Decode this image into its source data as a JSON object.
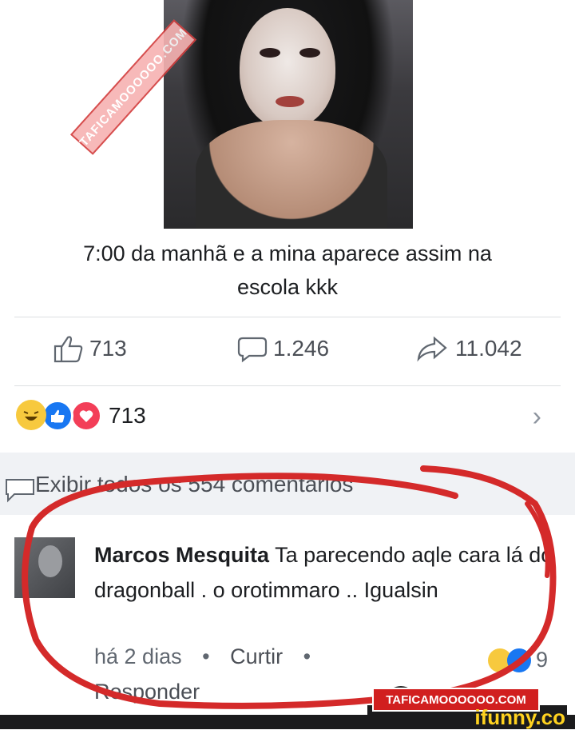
{
  "post": {
    "caption_line1": "7:00 da manhã e a mina aparece assim na",
    "caption_line2": "escola kkk",
    "photo_watermark": "TAFICAMOOOOOO.COM"
  },
  "stats": {
    "likes": "713",
    "comments": "1.246",
    "shares": "11.042"
  },
  "reactions": {
    "count": "713",
    "icons": [
      "haha-icon",
      "like-icon",
      "love-icon"
    ],
    "chevron": "›"
  },
  "comments_bar": {
    "label": "Exibir todos os 554 comentários"
  },
  "comment": {
    "author": "Marcos Mesquita",
    "text": "Ta parecendo aqle cara lá do dragonball . o orotimmaro .. Igualsin",
    "time": "há 2 dias",
    "like_action": "Curtir",
    "reply_action": "Responder",
    "reaction_count": "9"
  },
  "watermark": {
    "site": "TAFICAMOOOOOO.COM",
    "brand": "ifunny.co"
  },
  "colors": {
    "annotation_red": "#d42a2a",
    "link_gray": "#4b4f56",
    "like_blue": "#1877f2",
    "love_red": "#f33e58",
    "haha_yellow": "#f7c93e",
    "ifunny_yellow": "#ffd21f"
  }
}
